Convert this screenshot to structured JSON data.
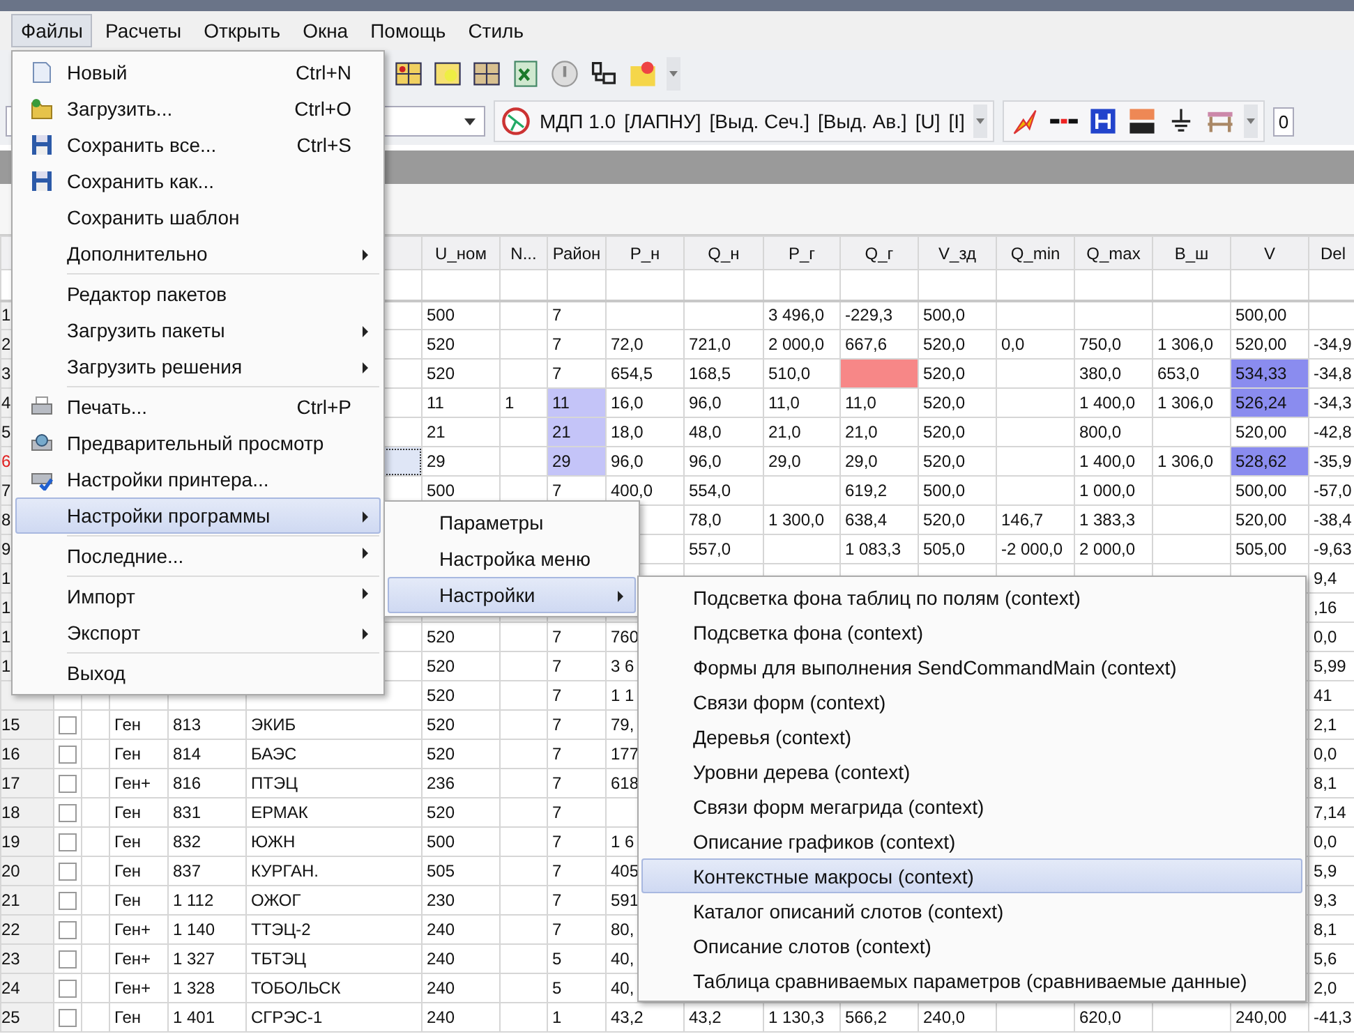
{
  "menu_bar": [
    {
      "label": "Файлы",
      "selected": true
    },
    {
      "label": "Расчеты",
      "selected": false
    },
    {
      "label": "Открыть",
      "selected": false
    },
    {
      "label": "Окна",
      "selected": false
    },
    {
      "label": "Помощь",
      "selected": false
    },
    {
      "label": "Стиль",
      "selected": false
    }
  ],
  "toolbar": {
    "mode_labels": [
      "МДП 1.0",
      "[ЛАПНУ]",
      "[Выд. Сеч.]",
      "[Выд. Ав.]",
      "[U]",
      "[I]"
    ],
    "field_value": "0"
  },
  "table": {
    "columns": [
      null,
      null,
      null,
      "U_ном",
      "N...",
      "Район",
      "P_н",
      "Q_н",
      "P_г",
      "Q_г",
      "V_зд",
      "Q_min",
      "Q_max",
      "B_ш",
      "V",
      "Del"
    ],
    "rows": [
      {
        "number": "1",
        "current": false,
        "cells": [
          null,
          null,
          null,
          "500",
          null,
          "7",
          null,
          null,
          "3 496,0",
          "-229,3",
          "500,0",
          null,
          null,
          null,
          "500,00",
          null
        ]
      },
      {
        "number": "2",
        "current": false,
        "cells": [
          null,
          null,
          null,
          "520",
          null,
          "7",
          "72,0",
          "721,0",
          "2 000,0",
          "667,6",
          "520,0",
          "0,0",
          "750,0",
          "1 306,0",
          "520,00",
          "-34,9"
        ]
      },
      {
        "number": "3",
        "current": false,
        "cells": [
          null,
          null,
          null,
          "520",
          null,
          "7",
          "654,5",
          "168,5",
          "510,0",
          {
            "color": "#f78787"
          },
          "520,0",
          null,
          "380,0",
          "653,0",
          {
            "text": "534,33",
            "color": "#8a8cef"
          },
          "-34,8"
        ]
      },
      {
        "number": "4",
        "current": false,
        "cells": [
          null,
          null,
          null,
          "11",
          "1",
          {
            "text": "11",
            "color": "#c4c4f8"
          },
          "16,0",
          "96,0",
          "11,0",
          "11,0",
          "520,0",
          null,
          "1 400,0",
          "1 306,0",
          {
            "text": "526,24",
            "color": "#8a8cef"
          },
          "-34,3"
        ]
      },
      {
        "number": "5",
        "current": false,
        "cells": [
          null,
          null,
          null,
          "21",
          null,
          {
            "text": "21",
            "color": "#c4c4f8"
          },
          "18,0",
          "48,0",
          "21,0",
          "21,0",
          "520,0",
          null,
          "800,0",
          null,
          "520,00",
          "-42,8"
        ]
      },
      {
        "number": "6",
        "current": true,
        "cells": [
          null,
          null,
          null,
          "29",
          null,
          {
            "text": "29",
            "color": "#c4c4f8"
          },
          "96,0",
          "96,0",
          "29,0",
          "29,0",
          "520,0",
          null,
          "1 400,0",
          "1 306,0",
          {
            "text": "528,62",
            "color": "#8a8cef"
          },
          "-35,9"
        ]
      },
      {
        "number": "7",
        "current": false,
        "cells": [
          null,
          null,
          null,
          "500",
          null,
          "7",
          "400,0",
          "554,0",
          null,
          "619,2",
          "500,0",
          null,
          "1 000,0",
          null,
          "500,00",
          "-57,0"
        ]
      },
      {
        "number": "8",
        "current": false,
        "cells": [
          null,
          null,
          null,
          null,
          null,
          null,
          null,
          "78,0",
          "1 300,0",
          "638,4",
          "520,0",
          "146,7",
          "1 383,3",
          null,
          "520,00",
          "-38,4"
        ]
      },
      {
        "number": "9",
        "current": false,
        "cells": [
          null,
          null,
          null,
          null,
          null,
          null,
          null,
          "557,0",
          null,
          "1 083,3",
          "505,0",
          "-2 000,0",
          "2 000,0",
          null,
          "505,00",
          "-9,63"
        ]
      },
      {
        "number": "1",
        "current": false,
        "cells": [
          null,
          null,
          null,
          null,
          null,
          null,
          null,
          null,
          null,
          null,
          null,
          null,
          null,
          null,
          null,
          "9,4"
        ]
      },
      {
        "number": "1",
        "current": false,
        "cells": [
          null,
          null,
          null,
          null,
          null,
          null,
          null,
          null,
          null,
          null,
          null,
          null,
          null,
          null,
          null,
          ",16"
        ]
      },
      {
        "number": "1",
        "current": false,
        "cells": [
          null,
          null,
          null,
          "520",
          null,
          "7",
          "760",
          null,
          null,
          null,
          null,
          null,
          null,
          null,
          null,
          "0,0"
        ]
      },
      {
        "number": "1",
        "current": false,
        "cells": [
          null,
          null,
          null,
          "520",
          null,
          "7",
          "3 6",
          null,
          null,
          null,
          null,
          null,
          null,
          null,
          null,
          "5,99"
        ]
      },
      {
        "cells": [
          null,
          null,
          null,
          "520",
          null,
          "7",
          "1 1",
          null,
          null,
          null,
          null,
          null,
          null,
          null,
          null,
          "41"
        ]
      },
      {
        "number": "15",
        "current": false,
        "checked": false,
        "cells": [
          "Ген",
          "813",
          "ЭКИБ",
          "520",
          null,
          "7",
          "79,",
          null,
          null,
          null,
          null,
          null,
          null,
          null,
          null,
          "2,1"
        ]
      },
      {
        "number": "16",
        "current": false,
        "checked": false,
        "cells": [
          "Ген",
          "814",
          "БАЭС",
          "520",
          null,
          "7",
          "177",
          null,
          null,
          null,
          null,
          null,
          null,
          null,
          null,
          "0,0"
        ]
      },
      {
        "number": "17",
        "current": false,
        "checked": false,
        "cells": [
          "Ген+",
          "816",
          "ПТЭЦ",
          "236",
          null,
          "7",
          "618",
          null,
          null,
          null,
          null,
          null,
          null,
          null,
          null,
          "8,1"
        ]
      },
      {
        "number": "18",
        "current": false,
        "checked": false,
        "cells": [
          "Ген",
          "831",
          "ЕРМАК",
          "520",
          null,
          "7",
          null,
          null,
          null,
          null,
          null,
          null,
          null,
          null,
          null,
          "7,14"
        ]
      },
      {
        "number": "19",
        "current": false,
        "checked": false,
        "cells": [
          "Ген",
          "832",
          "ЮЖН",
          "500",
          null,
          "7",
          "1 6",
          null,
          null,
          null,
          null,
          null,
          null,
          null,
          null,
          "0,0"
        ]
      },
      {
        "number": "20",
        "current": false,
        "checked": false,
        "cells": [
          "Ген",
          "837",
          "КУРГАН.",
          "505",
          null,
          "7",
          "405",
          null,
          null,
          null,
          null,
          null,
          null,
          null,
          null,
          "5,9"
        ]
      },
      {
        "number": "21",
        "current": false,
        "checked": false,
        "cells": [
          "Ген",
          "1 112",
          "ОЖОГ",
          "230",
          null,
          "7",
          "591",
          null,
          null,
          null,
          null,
          null,
          null,
          null,
          null,
          "9,3"
        ]
      },
      {
        "number": "22",
        "current": false,
        "checked": false,
        "cells": [
          "Ген+",
          "1 140",
          "ТТЭЦ-2",
          "240",
          null,
          "7",
          "80,",
          null,
          null,
          null,
          null,
          null,
          null,
          null,
          null,
          "8,1"
        ]
      },
      {
        "number": "23",
        "current": false,
        "checked": false,
        "cells": [
          "Ген+",
          "1 327",
          "ТБТЭЦ",
          "240",
          null,
          "5",
          "40,",
          null,
          null,
          null,
          null,
          null,
          null,
          null,
          null,
          "5,6"
        ]
      },
      {
        "number": "24",
        "current": false,
        "checked": false,
        "cells": [
          "Ген+",
          "1 328",
          "ТОБОЛЬСК",
          "240",
          null,
          "5",
          "40,",
          null,
          null,
          null,
          null,
          null,
          null,
          null,
          null,
          "2,0"
        ]
      },
      {
        "number": "25",
        "current": false,
        "checked": false,
        "cells": [
          "Ген",
          "1 401",
          "СГРЭС-1",
          "240",
          null,
          "1",
          "43,2",
          "43,2",
          "1 130,3",
          "566,2",
          "240,0",
          null,
          "620,0",
          null,
          "240,00",
          "-41,3"
        ]
      }
    ]
  },
  "main_menu": {
    "items": [
      {
        "label": "Новый",
        "shortcut": "Ctrl+N",
        "kind": "new",
        "submenu": false,
        "separator": false,
        "selected": false
      },
      {
        "label": "Загрузить...",
        "shortcut": "Ctrl+O",
        "kind": "open",
        "submenu": false,
        "separator": false,
        "selected": false
      },
      {
        "label": "Сохранить все...",
        "shortcut": "Ctrl+S",
        "kind": "save",
        "submenu": false,
        "separator": false,
        "selected": false
      },
      {
        "label": "Сохранить как...",
        "kind": "saveas",
        "submenu": false,
        "separator": false,
        "selected": false
      },
      {
        "label": "Сохранить шаблон",
        "submenu": false,
        "separator": false,
        "selected": false
      },
      {
        "label": "Дополнительно",
        "submenu": true,
        "separator": false,
        "selected": false
      },
      {
        "label": "Редактор пакетов",
        "submenu": false,
        "separator": true,
        "selected": false
      },
      {
        "label": "Загрузить пакеты",
        "submenu": true,
        "separator": false,
        "selected": false
      },
      {
        "label": "Загрузить решения",
        "submenu": true,
        "separator": false,
        "selected": false
      },
      {
        "label": "Печать...",
        "shortcut": "Ctrl+P",
        "kind": "print",
        "submenu": false,
        "separator": true,
        "selected": false
      },
      {
        "label": "Предварительный просмотр",
        "kind": "preview",
        "submenu": false,
        "separator": false,
        "selected": false
      },
      {
        "label": "Настройки принтера...",
        "kind": "printersetup",
        "submenu": false,
        "separator": false,
        "selected": false
      },
      {
        "label": "Настройки программы",
        "submenu": true,
        "separator": false,
        "selected": true
      },
      {
        "label": "Последние...",
        "submenu": true,
        "separator": true,
        "selected": false
      },
      {
        "label": "Импорт",
        "submenu": true,
        "separator": true,
        "selected": false
      },
      {
        "label": "Экспорт",
        "submenu": true,
        "separator": false,
        "selected": false
      },
      {
        "label": "Выход",
        "submenu": false,
        "separator": true,
        "selected": false
      }
    ]
  },
  "program_settings_menu": {
    "items": [
      {
        "label": "Параметры",
        "submenu": false,
        "selected": false
      },
      {
        "label": "Настройка меню",
        "submenu": false,
        "selected": false
      },
      {
        "label": "Настройки",
        "submenu": true,
        "selected": true
      }
    ]
  },
  "settings_menu": {
    "items": [
      {
        "label": "Подсветка фона таблиц по полям (context)",
        "selected": false
      },
      {
        "label": "Подсветка фона (context)",
        "selected": false
      },
      {
        "label": "Формы для выполнения SendCommandMain (context)",
        "selected": false
      },
      {
        "label": "Связи форм (context)",
        "selected": false
      },
      {
        "label": "Деревья (context)",
        "selected": false
      },
      {
        "label": "Уровни дерева (context)",
        "selected": false
      },
      {
        "label": "Связи форм мегагрида (context)",
        "selected": false
      },
      {
        "label": "Описание графиков (context)",
        "selected": false
      },
      {
        "label": "Контекстные макросы (context)",
        "selected": true
      },
      {
        "label": "Каталог описаний слотов (context)",
        "selected": false
      },
      {
        "label": "Описание слотов (context)",
        "selected": false
      },
      {
        "label": "Таблица сравниваемых параметров (сравниваемые данные)",
        "selected": false
      }
    ]
  }
}
